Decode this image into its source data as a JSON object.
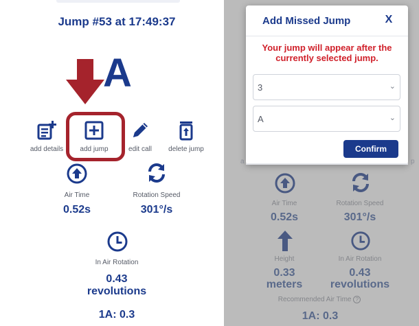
{
  "left": {
    "jump_title": "Jump #53 at 17:49:37",
    "big_letter": "A",
    "actions": {
      "add_details": "add details",
      "add_jump": "add jump",
      "edit_call": "edit call",
      "delete_jump": "delete jump"
    },
    "metrics": {
      "air_time_label": "Air Time",
      "air_time_value": "0.52s",
      "rotation_speed_label": "Rotation Speed",
      "rotation_speed_value": "301°/s",
      "in_air_rotation_label": "In Air Rotation",
      "in_air_rotation_value_line1": "0.43",
      "in_air_rotation_value_line2": "revolutions",
      "jump_code": "1A: 0.3"
    }
  },
  "right": {
    "metrics": {
      "air_time_label": "Air Time",
      "air_time_value": "0.52s",
      "rotation_speed_label": "Rotation Speed",
      "rotation_speed_value": "301°/s",
      "height_label": "Height",
      "height_value_line1": "0.33",
      "height_value_line2": "meters",
      "in_air_rotation_label": "In Air Rotation",
      "in_air_rotation_value_line1": "0.43",
      "in_air_rotation_value_line2": "revolutions",
      "recommended_label": "Recommended Air Time",
      "jump_code": "1A: 0.3"
    },
    "modal": {
      "title": "Add Missed Jump",
      "close": "X",
      "warning": "Your jump will appear after the currently selected jump.",
      "select_rotation": "3",
      "select_jump_type": "A",
      "confirm": "Confirm"
    }
  },
  "colors": {
    "primary": "#1b3a8c",
    "highlight": "#a5232c",
    "warning": "#d0202a"
  }
}
